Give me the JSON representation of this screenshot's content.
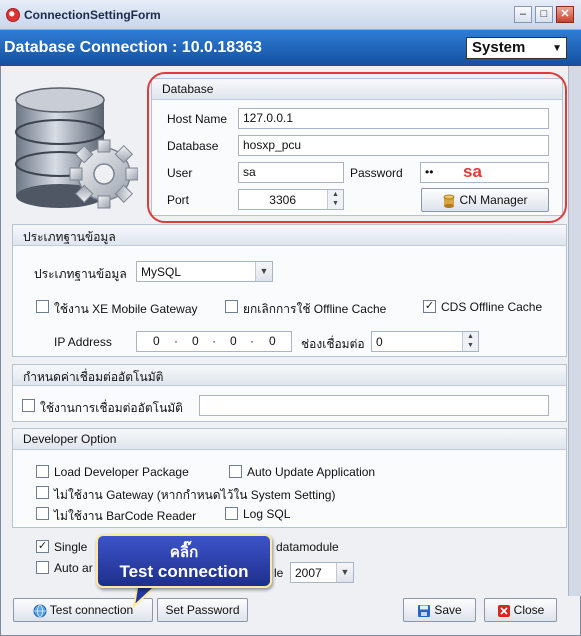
{
  "window": {
    "title": "ConnectionSettingForm",
    "header_title": "Database Connection : 10.0.18363",
    "theme_value": "System"
  },
  "database": {
    "title": "Database",
    "host_label": "Host Name",
    "host_value": "127.0.0.1",
    "db_label": "Database",
    "db_value": "hosxp_pcu",
    "user_label": "User",
    "user_value": "sa",
    "password_label": "Password",
    "password_value": "••",
    "password_annotation": "sa",
    "port_label": "Port",
    "port_value": "3306",
    "cn_manager_label": "CN Manager"
  },
  "dbtype": {
    "title": "ประเภทฐานข้อมูล",
    "type_label": "ประเภทฐานข้อมูล",
    "type_value": "MySQL",
    "xe_gateway_label": "ใช้งาน XE Mobile Gateway",
    "xe_gateway_checked": false,
    "cancel_offline_label": "ยกเลิกการใช้ Offline Cache",
    "cancel_offline_checked": false,
    "cds_offline_label": "CDS Offline Cache",
    "cds_offline_checked": true,
    "ip_label": "IP Address",
    "ip_octets": [
      "0",
      "0",
      "0",
      "0"
    ],
    "channel_label": "ช่องเชื่อมต่อ",
    "channel_value": "0"
  },
  "autoconnect": {
    "title": "กำหนดค่าเชื่อมต่ออัตโนมัติ",
    "enable_label": "ใช้งานการเชื่อมต่ออัตโนมัติ",
    "enable_checked": false,
    "value": ""
  },
  "developer": {
    "title": "Developer Option",
    "load_dev_label": "Load Developer Package",
    "auto_update_label": "Auto Update Application",
    "no_gateway_label": "ไม่ใช้งาน Gateway (หากกำหนดไว้ใน System Setting)",
    "no_barcode_label": "ไม่ใช้งาน BarCode Reader",
    "log_sql_label": "Log SQL"
  },
  "bottom": {
    "single_label_start": "Single",
    "single_label_end": "datamodule",
    "single_checked": true,
    "auto_label_start": "Auto ar",
    "auto_label_end": "le",
    "auto_checked": false,
    "year_value": "2007"
  },
  "buttons": {
    "test_label": "Test connection",
    "set_password_label": "Set Password",
    "save_label": "Save",
    "close_label": "Close"
  },
  "callout": {
    "line1": "คลิ๊ก",
    "line2": "Test connection"
  },
  "colors": {
    "header_blue": "#1f63b8",
    "annotation_red": "#e03a3a",
    "callout_blue": "#2b3fae"
  }
}
